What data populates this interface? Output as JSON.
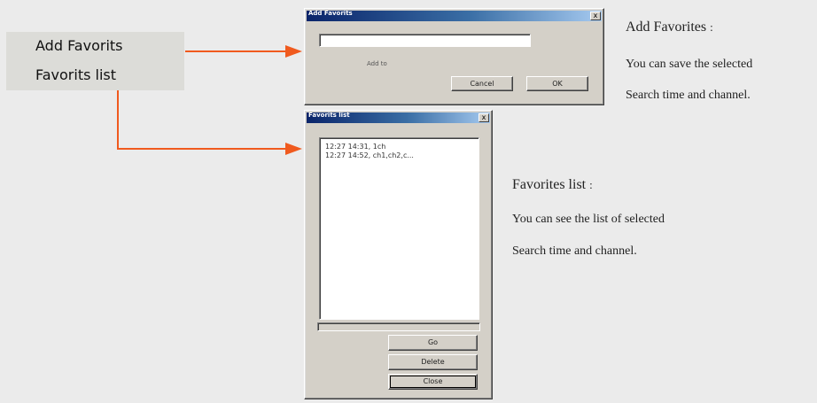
{
  "menu": {
    "items": [
      {
        "label": "Add Favorits"
      },
      {
        "label": "Favorits list"
      }
    ]
  },
  "colors": {
    "arrow": "#f05a1e",
    "menu_bg": "#dcdcd8",
    "dialog_bg": "#d4d0c8",
    "titlebar_start": "#0a246a"
  },
  "add_dialog": {
    "title": "Add Favorits",
    "close_glyph": "x",
    "name_value": "",
    "hint_label": "Add to",
    "cancel_label": "Cancel",
    "ok_label": "OK"
  },
  "list_dialog": {
    "title": "Favorits list",
    "close_glyph": "x",
    "items": [
      {
        "text": "12:27 14:31, 1ch"
      },
      {
        "text": "12:27 14:52, ch1,ch2,c..."
      }
    ],
    "go_label": "Go",
    "delete_label": "Delete",
    "close_label": "Close"
  },
  "descriptions": {
    "add": {
      "title": "Add Favorites",
      "colon": ":",
      "lines": [
        "You can save the selected",
        "Search time and channel."
      ]
    },
    "list": {
      "title": "Favorites list",
      "colon": ":",
      "lines": [
        "You can see the list of selected",
        "Search time and channel."
      ]
    }
  }
}
